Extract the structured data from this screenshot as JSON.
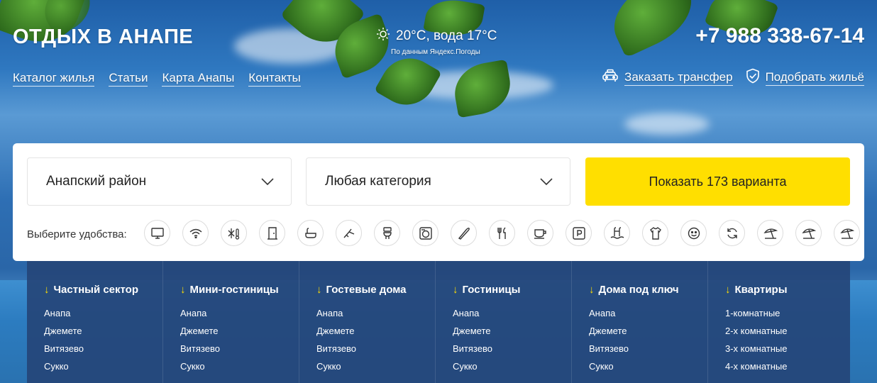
{
  "header": {
    "logo": "ОТДЫХ В АНАПЕ",
    "weather": "20°C, вода 17°C",
    "weather_source": "По данным Яндекс.Погоды",
    "phone": "+7 988 338-67-14"
  },
  "nav": [
    {
      "label": "Каталог жилья"
    },
    {
      "label": "Статьи"
    },
    {
      "label": "Карта Анапы"
    },
    {
      "label": "Контакты"
    }
  ],
  "actions": {
    "transfer": "Заказать трансфер",
    "pick": "Подобрать жильё"
  },
  "search": {
    "district": "Анапский район",
    "category": "Любая категория",
    "show_button": "Показать 173 варианта",
    "amenities_label": "Выберите удобства:",
    "amenities": [
      "tv-icon",
      "wifi-icon",
      "ac-icon",
      "fridge-icon",
      "bath-icon",
      "kitchen-icon",
      "toilet-icon",
      "washing-machine-icon",
      "iron-icon",
      "dining-icon",
      "tea-icon",
      "parking-icon",
      "pool-icon",
      "clothes-icon",
      "kids-icon",
      "transfer-icon",
      "beach-umbrella-icon",
      "beach-umbrella-icon",
      "beach-umbrella-icon"
    ]
  },
  "categories": [
    {
      "title": "Частный сектор",
      "items": [
        "Анапа",
        "Джемете",
        "Витязево",
        "Сукко"
      ]
    },
    {
      "title": "Мини-гостиницы",
      "items": [
        "Анапа",
        "Джемете",
        "Витязево",
        "Сукко"
      ]
    },
    {
      "title": "Гостевые дома",
      "items": [
        "Анапа",
        "Джемете",
        "Витязево",
        "Сукко"
      ]
    },
    {
      "title": "Гостиницы",
      "items": [
        "Анапа",
        "Джемете",
        "Витязево",
        "Сукко"
      ]
    },
    {
      "title": "Дома под ключ",
      "items": [
        "Анапа",
        "Джемете",
        "Витязево",
        "Сукко"
      ]
    },
    {
      "title": "Квартиры",
      "items": [
        "1-комнатные",
        "2-х комнатные",
        "3-х комнатные",
        "4-х комнатные"
      ]
    }
  ],
  "colors": {
    "accent": "#ffdf00",
    "panel": "#ffffff",
    "categories_bg": "#254578"
  }
}
